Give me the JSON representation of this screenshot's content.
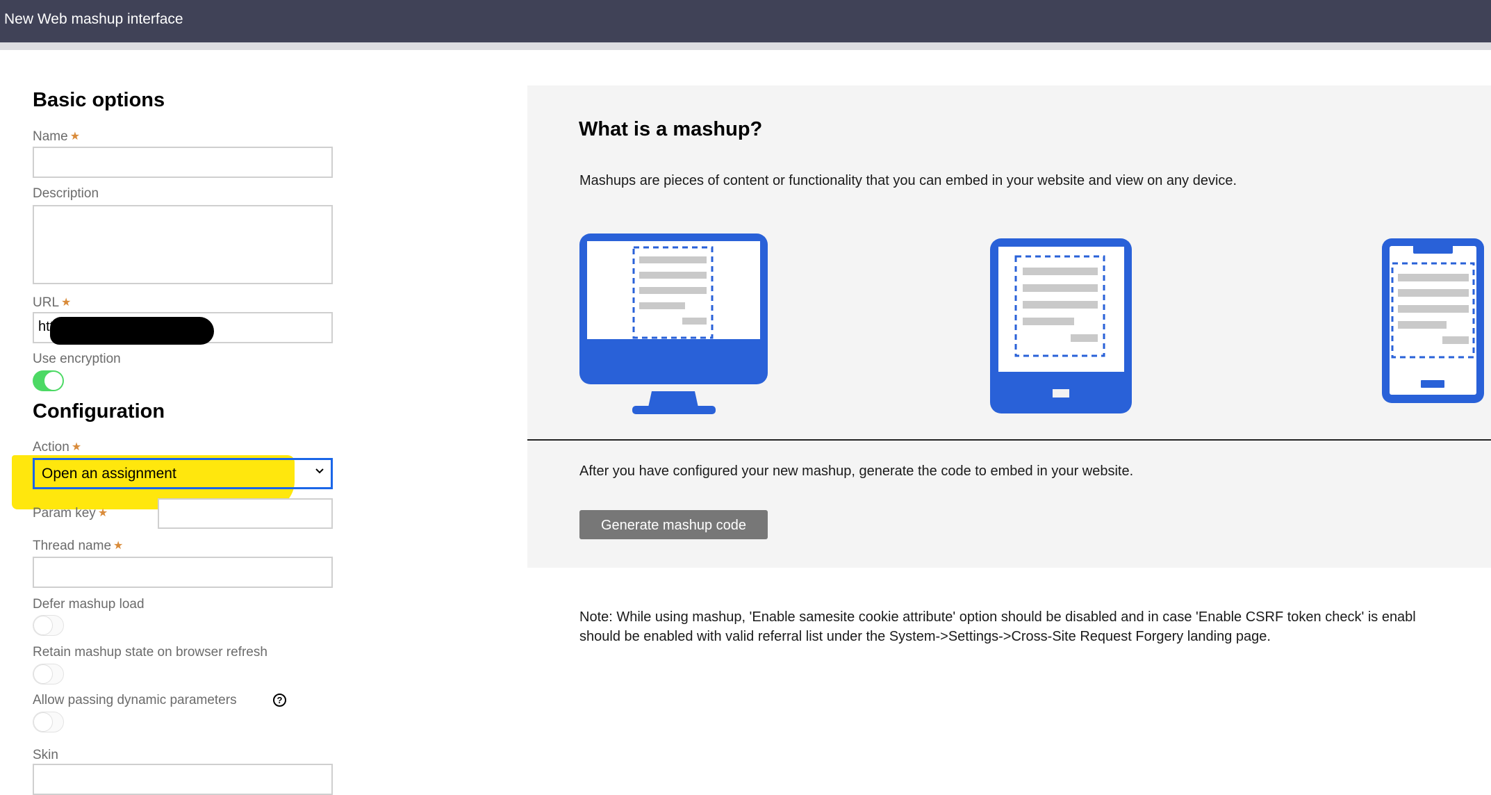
{
  "window": {
    "title": "New Web mashup interface"
  },
  "basic_options": {
    "heading": "Basic options",
    "name": {
      "label": "Name",
      "required": true,
      "value": ""
    },
    "description": {
      "label": "Description",
      "value": ""
    },
    "url": {
      "label": "URL",
      "required": true,
      "value_visible_prefix": "http",
      "redacted": true
    },
    "use_encryption": {
      "label": "Use encryption",
      "checked": true
    }
  },
  "configuration": {
    "heading": "Configuration",
    "action": {
      "label": "Action",
      "required": true,
      "selected": "Open an assignment"
    },
    "param_key": {
      "label": "Param key",
      "required": true,
      "value": ""
    },
    "thread_name": {
      "label": "Thread name",
      "required": true,
      "value": ""
    },
    "defer_mashup_load": {
      "label": "Defer mashup load",
      "checked": false
    },
    "retain_state": {
      "label": "Retain mashup state on browser refresh",
      "checked": false
    },
    "allow_dynamic_params": {
      "label": "Allow passing dynamic parameters",
      "checked": false,
      "help_icon": "question-circle-icon"
    },
    "skin": {
      "label": "Skin",
      "value": ""
    }
  },
  "required_marker": "★",
  "info_panel": {
    "heading": "What is a mashup?",
    "description": "Mashups are pieces of content or functionality that you can embed in your website and view on any device.",
    "devices": [
      "desktop-monitor-icon",
      "tablet-icon",
      "phone-icon"
    ],
    "after_text": "After you have configured your new mashup, generate the code to embed in your website.",
    "generate_button": "Generate mashup code"
  },
  "note": {
    "line1": "Note: While using mashup, 'Enable samesite cookie attribute' option should be disabled and in case 'Enable CSRF token check' is enabl",
    "line2": "should be enabled with valid referral list under the System->Settings->Cross-Site Request Forgery landing page."
  },
  "colors": {
    "titlebar": "#404257",
    "accent_blue": "#2961d8",
    "toggle_on": "#4cd964",
    "required": "#d98b3a",
    "highlight": "#ffe600",
    "button_gray": "#777777"
  }
}
